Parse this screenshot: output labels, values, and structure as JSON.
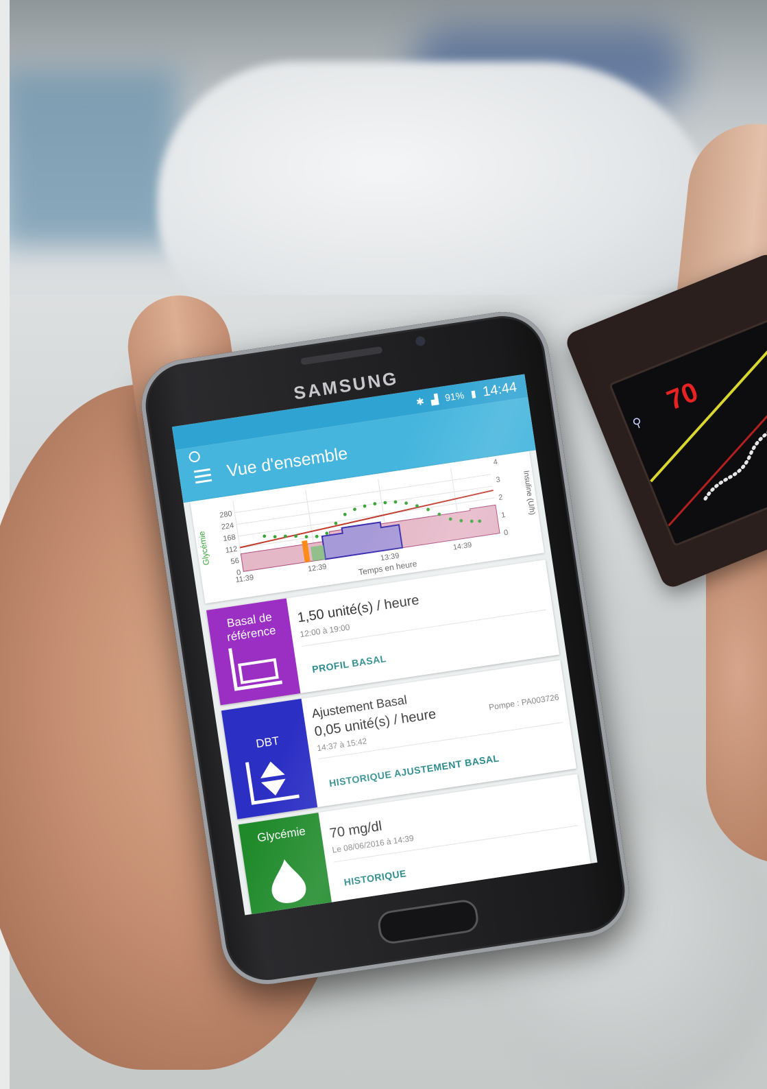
{
  "phone": {
    "brand": "SAMSUNG",
    "status": {
      "battery": "91%",
      "time": "14:44"
    }
  },
  "app": {
    "title": "Vue d'ensemble"
  },
  "chart_data": {
    "type": "line",
    "xlabel": "Temps en heure",
    "ylabel": "Glycémie",
    "y2label": "Insuline (U/h)",
    "x_ticks": [
      "11:39",
      "12:39",
      "13:39",
      "14:39"
    ],
    "y_ticks": [
      0,
      56,
      112,
      168,
      224,
      280
    ],
    "y2_ticks": [
      0,
      1,
      2,
      3,
      4
    ],
    "ylim": [
      0,
      336
    ],
    "y2lim": [
      0,
      4
    ],
    "glucose_points": [
      [
        0.1,
        150
      ],
      [
        0.14,
        140
      ],
      [
        0.18,
        135
      ],
      [
        0.22,
        128
      ],
      [
        0.26,
        118
      ],
      [
        0.3,
        112
      ],
      [
        0.34,
        120
      ],
      [
        0.38,
        160
      ],
      [
        0.42,
        195
      ],
      [
        0.46,
        212
      ],
      [
        0.5,
        220
      ],
      [
        0.54,
        224
      ],
      [
        0.58,
        222
      ],
      [
        0.62,
        218
      ],
      [
        0.66,
        205
      ],
      [
        0.7,
        185
      ],
      [
        0.74,
        160
      ],
      [
        0.78,
        130
      ],
      [
        0.82,
        100
      ],
      [
        0.86,
        85
      ],
      [
        0.9,
        75
      ],
      [
        0.93,
        70
      ]
    ],
    "target_line": 2.2,
    "basal_profile": [
      [
        0.0,
        1.0
      ],
      [
        0.35,
        1.0
      ],
      [
        0.35,
        1.5
      ],
      [
        0.9,
        1.5
      ],
      [
        0.9,
        1.6
      ],
      [
        1.0,
        1.6
      ]
    ],
    "temp_basal": [
      [
        0.32,
        0.6
      ],
      [
        0.32,
        1.3
      ],
      [
        0.4,
        1.3
      ],
      [
        0.4,
        1.6
      ],
      [
        0.55,
        1.6
      ],
      [
        0.55,
        1.3
      ],
      [
        0.62,
        1.3
      ],
      [
        0.62,
        0.6
      ]
    ],
    "boluses": [
      {
        "x": 0.25,
        "value": 1.2,
        "color": "#ff8c1a"
      }
    ],
    "colors": {
      "glucose": "#3aa63a",
      "target": "#c0392b",
      "basal_fill": "#e5b8c8",
      "temp_fill": "#a79ad8",
      "temp_line": "#3b2fb0"
    }
  },
  "cards": {
    "basal": {
      "tile": "Basal de référence",
      "main": "1,50 unité(s) / heure",
      "sub": "12:00 à 19:00",
      "action": "PROFIL BASAL",
      "color": "#9b2fc4"
    },
    "dbt": {
      "tile": "DBT",
      "title": "Ajustement Basal",
      "main": "0,05 unité(s) / heure",
      "sub": "14:37 à 15:42",
      "pump": "Pompe : PA003726",
      "action": "HISTORIQUE AJUSTEMENT BASAL",
      "color": "#2c2fc4"
    },
    "glycemie": {
      "tile": "Glycémie",
      "main": "70 mg/dl",
      "sub": "Le 08/06/2016 à 14:39",
      "action": "HISTORIQUE",
      "color": "#1f8a2a"
    }
  },
  "pump_device": {
    "glucose": "70"
  }
}
